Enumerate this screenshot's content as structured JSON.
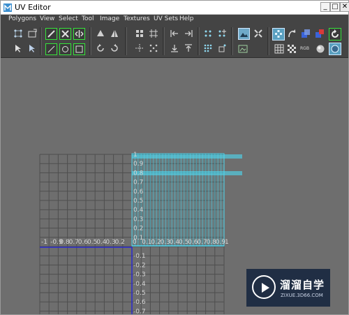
{
  "window": {
    "title": "UV Editor",
    "controls": {
      "minimize": "_",
      "maximize": "□",
      "close": "✕"
    }
  },
  "menu": [
    "Polygons",
    "View",
    "Select",
    "Tool",
    "Image",
    "Textures",
    "UV Sets",
    "Help"
  ],
  "toolbar": {
    "icons": [
      "select-vertex-icon",
      "move-uv-shell-icon",
      "cut-uv-edge-icon",
      "flip-uv-icon",
      "rotate-uv-icon",
      "snap-uv-icon",
      "align-uv-icon",
      "layout-uv-icon",
      "isolate-select-icon",
      "display-image-icon",
      "grid-icon",
      "texture-borders-icon",
      "checker-icon",
      "rgb-channels-icon",
      "sphere-icon",
      "refresh-icon"
    ],
    "rgb_label": "RGB"
  },
  "uv_editor": {
    "axis_v_labels_positive": [
      "1",
      "0.9",
      "0.8",
      "0.7",
      "0.6",
      "0.5",
      "0.4",
      "0.3",
      "0.2",
      "0.1"
    ],
    "axis_v_labels_negative": [
      "-0.1",
      "-0.2",
      "-0.3",
      "-0.4",
      "-0.5",
      "-0.6",
      "-0.7"
    ],
    "axis_u_labels_negative": [
      "-1",
      "-0.9",
      "0.8",
      "0.7",
      "0.6",
      "0.5",
      "0.4",
      "0.3",
      "0.2"
    ],
    "axis_u_labels_positive": [
      "0",
      "0.1",
      "0.2",
      "0.3",
      "0.4",
      "0.5",
      "0.6",
      "0.7",
      "0.8",
      "0.9",
      "1"
    ],
    "colors": {
      "background": "#6e6e6e",
      "grid": "#4e4e4e",
      "uv_shell": "#4fd6ee",
      "axis_highlight": "#2a2ad0",
      "text": "#d6d6d6"
    }
  },
  "watermark": {
    "title": "溜溜自学",
    "url": "ZIXUE.3D66.COM"
  }
}
